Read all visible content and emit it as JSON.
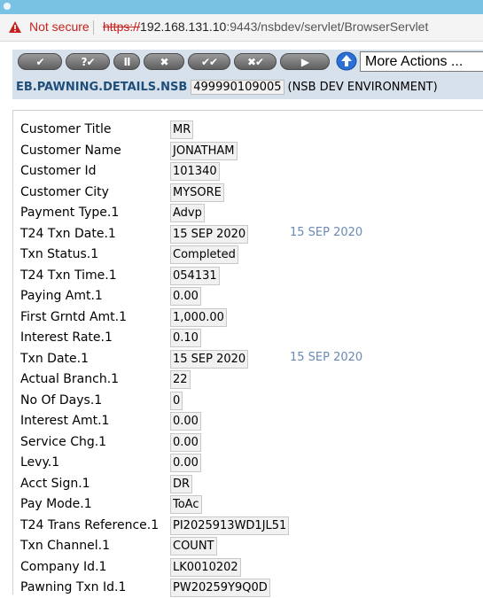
{
  "browser": {
    "security_label": "Not secure",
    "url_scheme": "https://",
    "url_host": "192.168.131.10",
    "url_rest": ":9443/nsbdev/servlet/BrowserServlet"
  },
  "toolbar": {
    "buttons": [
      {
        "label": "✔"
      },
      {
        "label": "?✔"
      },
      {
        "label": "II"
      },
      {
        "label": "✖"
      },
      {
        "label": "✔✔"
      },
      {
        "label": "✖✔"
      },
      {
        "label": "▶"
      }
    ],
    "more_actions": "More Actions ..."
  },
  "header": {
    "application": "EB.PAWNING.DETAILS.NSB",
    "record_id": "499990109005",
    "environment": "(NSB DEV ENVIRONMENT)"
  },
  "fields": [
    {
      "label": "Customer Title",
      "value": "MR",
      "extra": ""
    },
    {
      "label": "Customer Name",
      "value": "JONATHAM",
      "extra": ""
    },
    {
      "label": "Customer Id",
      "value": "101340",
      "extra": ""
    },
    {
      "label": "Customer City",
      "value": "MYSORE",
      "extra": ""
    },
    {
      "label": "Payment Type.1",
      "value": "Advp",
      "extra": ""
    },
    {
      "label": "T24 Txn Date.1",
      "value": "15 SEP 2020",
      "extra": "15 SEP 2020"
    },
    {
      "label": "Txn Status.1",
      "value": "Completed",
      "extra": ""
    },
    {
      "label": "T24 Txn Time.1",
      "value": "054131",
      "extra": ""
    },
    {
      "label": "Paying Amt.1",
      "value": "0.00",
      "extra": ""
    },
    {
      "label": "First Grntd Amt.1",
      "value": "1,000.00",
      "extra": ""
    },
    {
      "label": "Interest Rate.1",
      "value": "0.10",
      "extra": ""
    },
    {
      "label": "Txn Date.1",
      "value": "15 SEP 2020",
      "extra": "15 SEP 2020"
    },
    {
      "label": "Actual Branch.1",
      "value": "22",
      "extra": ""
    },
    {
      "label": "No Of Days.1",
      "value": "0",
      "extra": ""
    },
    {
      "label": "Interest Amt.1",
      "value": "0.00",
      "extra": ""
    },
    {
      "label": "Service Chg.1",
      "value": "0.00",
      "extra": ""
    },
    {
      "label": "Levy.1",
      "value": "0.00",
      "extra": ""
    },
    {
      "label": "Acct Sign.1",
      "value": "DR",
      "extra": ""
    },
    {
      "label": "Pay Mode.1",
      "value": "ToAc",
      "extra": ""
    },
    {
      "label": "T24 Trans Reference.1",
      "value": "PI2025913WD1JL51",
      "extra": ""
    },
    {
      "label": "Txn Channel.1",
      "value": "COUNT",
      "extra": ""
    },
    {
      "label": "Company Id.1",
      "value": "LK0010202",
      "extra": ""
    },
    {
      "label": "Pawning Txn Id.1",
      "value": "PW20259Y9Q0D",
      "extra": ""
    }
  ]
}
